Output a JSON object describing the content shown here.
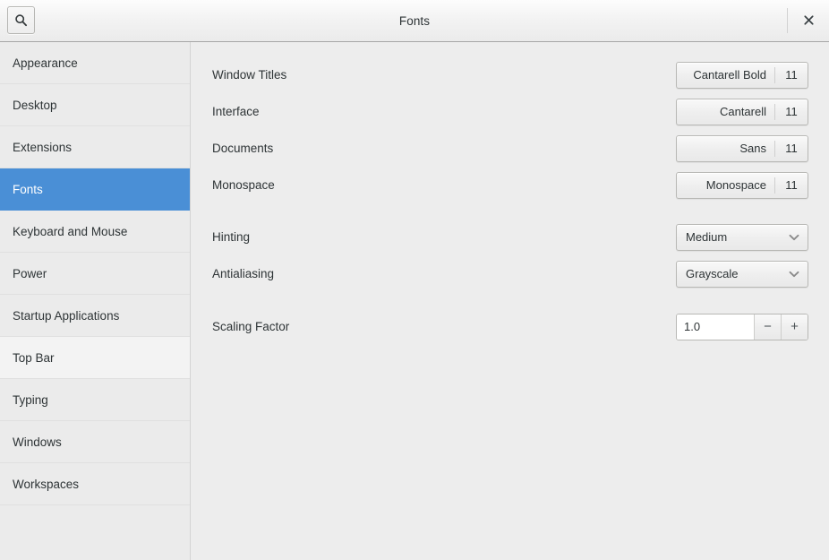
{
  "window": {
    "title": "Fonts",
    "search_icon": "search-icon",
    "close_icon": "close-icon",
    "close_label": "×"
  },
  "sidebar": {
    "items": [
      {
        "label": "Appearance",
        "state": "normal"
      },
      {
        "label": "Desktop",
        "state": "normal"
      },
      {
        "label": "Extensions",
        "state": "normal"
      },
      {
        "label": "Fonts",
        "state": "selected"
      },
      {
        "label": "Keyboard and Mouse",
        "state": "normal"
      },
      {
        "label": "Power",
        "state": "normal"
      },
      {
        "label": "Startup Applications",
        "state": "normal"
      },
      {
        "label": "Top Bar",
        "state": "hovered"
      },
      {
        "label": "Typing",
        "state": "normal"
      },
      {
        "label": "Windows",
        "state": "normal"
      },
      {
        "label": "Workspaces",
        "state": "normal"
      }
    ],
    "selected_color": "#4a8fd6"
  },
  "content": {
    "font_rows": [
      {
        "label": "Window Titles",
        "font": "Cantarell Bold",
        "size": "11"
      },
      {
        "label": "Interface",
        "font": "Cantarell",
        "size": "11"
      },
      {
        "label": "Documents",
        "font": "Sans",
        "size": "11"
      },
      {
        "label": "Monospace",
        "font": "Monospace",
        "size": "11"
      }
    ],
    "hinting": {
      "label": "Hinting",
      "value": "Medium"
    },
    "antialiasing": {
      "label": "Antialiasing",
      "value": "Grayscale"
    },
    "scaling": {
      "label": "Scaling Factor",
      "value": "1.0",
      "minus": "−",
      "plus": "+"
    }
  }
}
